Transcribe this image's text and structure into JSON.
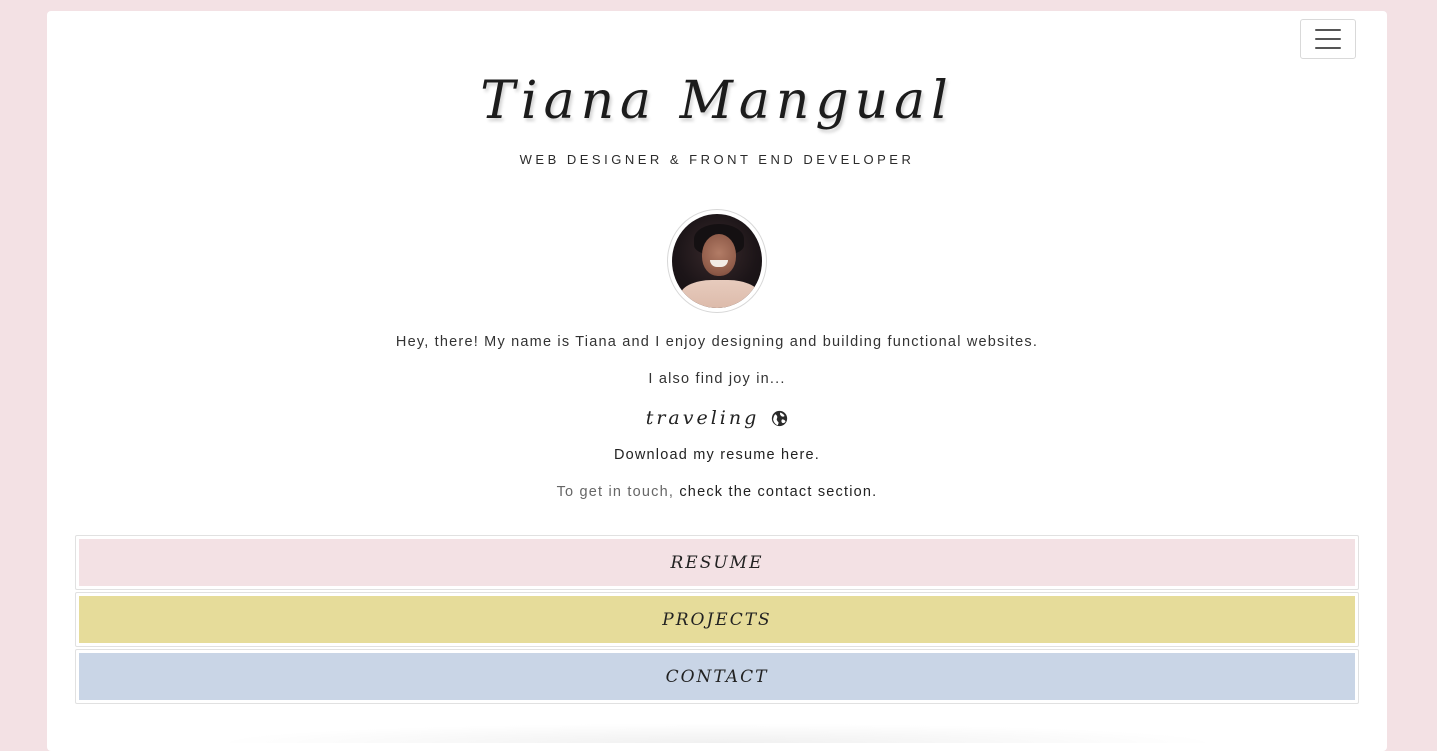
{
  "header": {
    "title": "Tiana Mangual",
    "subtitle": "WEB DESIGNER & FRONT END DEVELOPER"
  },
  "nav": {
    "menu_icon": "hamburger-menu-icon"
  },
  "intro": {
    "greeting": "Hey, there! My name is Tiana and I enjoy designing and building functional websites.",
    "also_find": "I also find joy in...",
    "hobby": "traveling",
    "hobby_icon": "globe-icon",
    "resume_link": "Download my resume here.",
    "contact_prefix": "To get in touch, ",
    "contact_link": "check the contact section."
  },
  "sections": [
    {
      "label": "RESUME",
      "color": "#f3e1e4"
    },
    {
      "label": "PROJECTS",
      "color": "#e6dc9a"
    },
    {
      "label": "CONTACT",
      "color": "#c9d5e6"
    }
  ],
  "colors": {
    "page_background": "#f3e1e4",
    "card_background": "#ffffff"
  }
}
